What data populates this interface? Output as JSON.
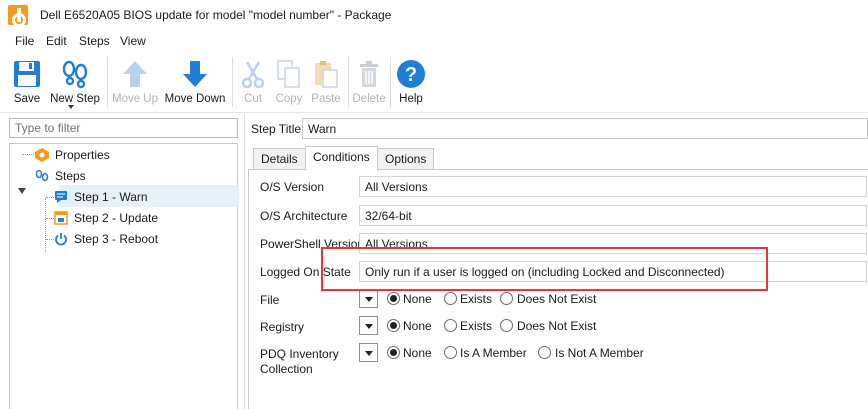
{
  "window": {
    "title": "Dell E6520A05 BIOS update for model \"model number\" - Package",
    "app_icon": "pdq-deploy-icon"
  },
  "menu": [
    "File",
    "Edit",
    "Steps",
    "View"
  ],
  "toolbar": {
    "save": "Save",
    "new_step": "New Step",
    "move_up": "Move Up",
    "move_down": "Move Down",
    "cut": "Cut",
    "copy": "Copy",
    "paste": "Paste",
    "delete": "Delete",
    "help": "Help"
  },
  "left": {
    "filter_placeholder": "Type to filter",
    "tree": {
      "properties": "Properties",
      "steps": "Steps",
      "items": [
        "Step 1 - Warn",
        "Step 2 - Update",
        "Step 3 - Reboot"
      ]
    }
  },
  "right": {
    "step_title_label": "Step Title",
    "step_title_value": "Warn",
    "tabs": [
      "Details",
      "Conditions",
      "Options"
    ],
    "active_tab": "Conditions",
    "conditions": {
      "os_version": {
        "label": "O/S Version",
        "value": "All Versions"
      },
      "os_arch": {
        "label": "O/S Architecture",
        "value": "32/64-bit"
      },
      "powershell": {
        "label": "PowerShell Version",
        "value": "All Versions"
      },
      "logged_on": {
        "label": "Logged On State",
        "value": "Only run if a user is logged on (including Locked and Disconnected)"
      },
      "file": {
        "label": "File",
        "options": [
          "None",
          "Exists",
          "Does Not Exist"
        ],
        "selected": "None"
      },
      "registry": {
        "label": "Registry",
        "options": [
          "None",
          "Exists",
          "Does Not Exist"
        ],
        "selected": "None"
      },
      "pdq": {
        "label1": "PDQ Inventory",
        "label2": "Collection",
        "options": [
          "None",
          "Is A Member",
          "Is Not A Member"
        ],
        "selected": "None"
      }
    }
  },
  "colors": {
    "highlight": "#e23a3a",
    "accent_blue": "#1f7fd6",
    "app_orange": "#f59a1b",
    "selection": "#e5f0fb"
  }
}
